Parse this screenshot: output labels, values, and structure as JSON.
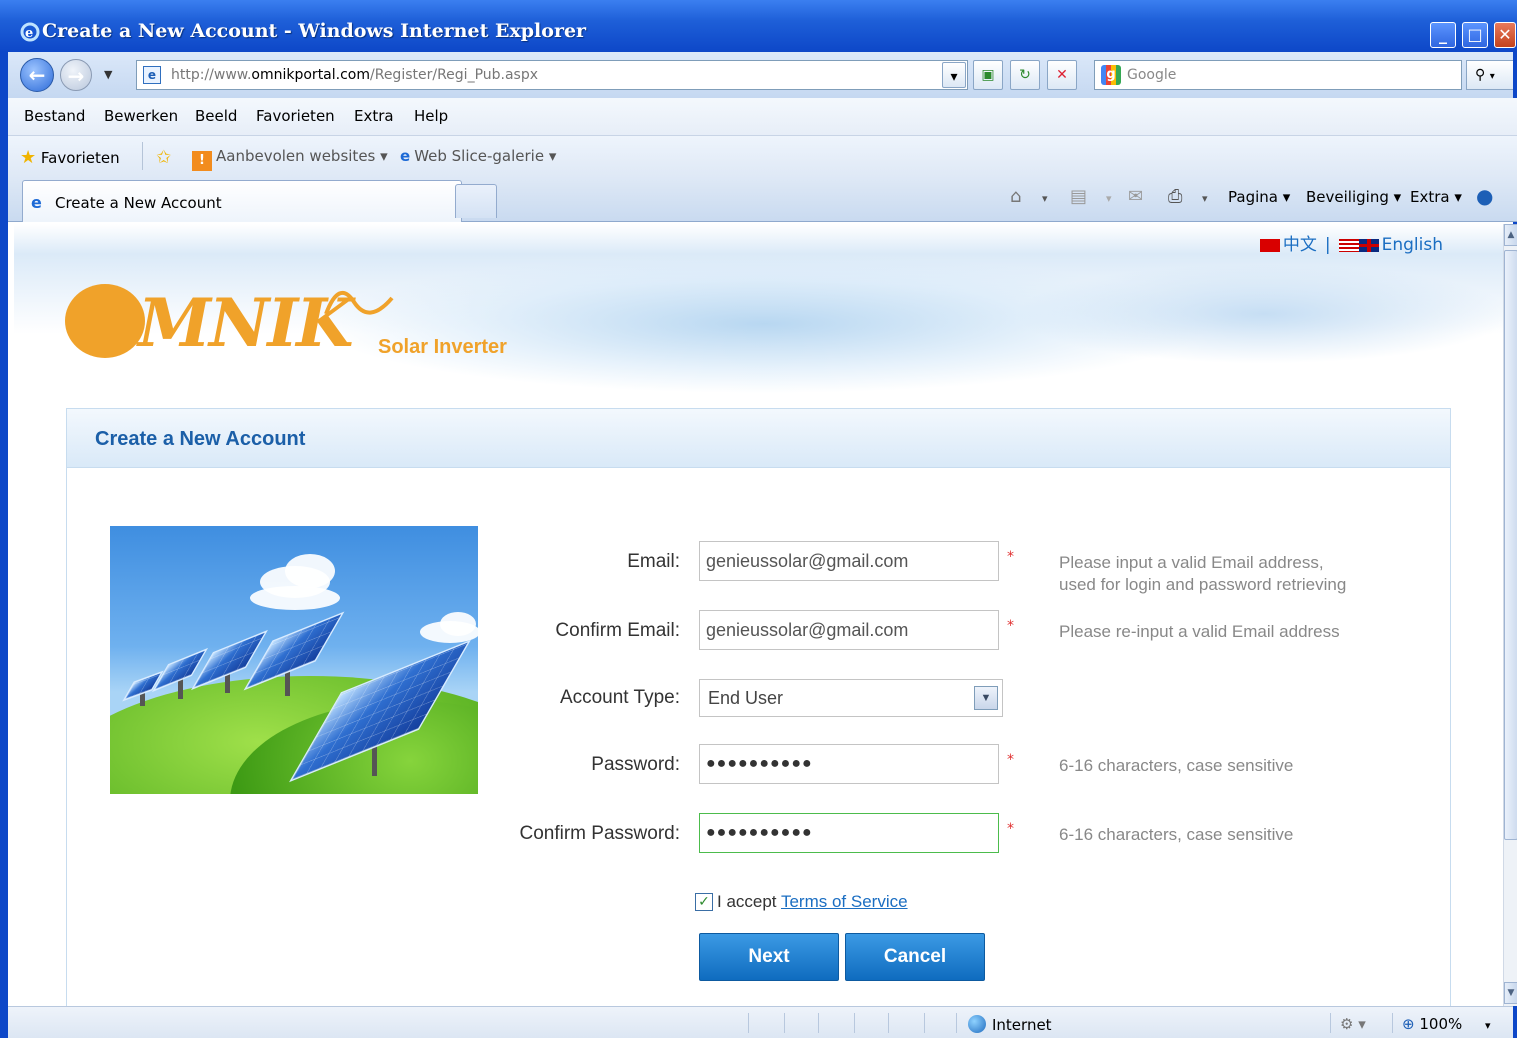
{
  "window": {
    "title": "Create a New Account - Windows Internet Explorer",
    "minimize": "_",
    "maximize": "□",
    "close": "✕"
  },
  "addressbar": {
    "url_prefix": "http://www.",
    "url_domain": "omnikportal.com",
    "url_path": "/Register/Regi_Pub.aspx",
    "search_placeholder": "Google",
    "page_icon": "e"
  },
  "menu": [
    "Bestand",
    "Bewerken",
    "Beeld",
    "Favorieten",
    "Extra",
    "Help"
  ],
  "favorites": {
    "favorites_label": "Favorieten",
    "suggested_sites": "Aanbevolen websites ▾",
    "web_slice": "Web Slice-galerie ▾"
  },
  "tabs": {
    "active_tab": "Create a New Account"
  },
  "commandbar": {
    "page": "Pagina ▾",
    "security": "Beveiliging ▾",
    "tools": "Extra ▾"
  },
  "page": {
    "lang_chinese": "中文",
    "lang_separator": "|",
    "lang_english": "English",
    "logo_text": "MNIK",
    "logo_subtitle": "Solar Inverter",
    "panel_title": "Create a New Account",
    "form": {
      "email_label": "Email:",
      "email_value": "genieussolar@gmail.com",
      "email_hint_1": "Please input a valid Email address,",
      "email_hint_2": "used for login and password retrieving",
      "confirm_email_label": "Confirm Email:",
      "confirm_email_value": "genieussolar@gmail.com",
      "confirm_email_hint": "Please re-input a valid Email address",
      "account_type_label": "Account Type:",
      "account_type_value": "End User",
      "password_label": "Password:",
      "password_value": "●●●●●●●●●●",
      "password_hint": "6-16 characters, case sensitive",
      "confirm_password_label": "Confirm Password:",
      "confirm_password_value": "●●●●●●●●●●",
      "confirm_password_hint": "6-16 characters, case sensitive",
      "required_mark": "*",
      "accept_text": "I accept",
      "terms_link": "Terms of Service",
      "terms_accepted": true,
      "next_button": "Next",
      "cancel_button": "Cancel"
    }
  },
  "statusbar": {
    "zone": "Internet",
    "zoom": "100%"
  },
  "colors": {
    "brand_orange": "#f0a22a",
    "panel_title_blue": "#1b5fa8",
    "button_blue": "#0f6cbf",
    "required_red": "#e03030",
    "link_blue": "#1b6ec2"
  }
}
